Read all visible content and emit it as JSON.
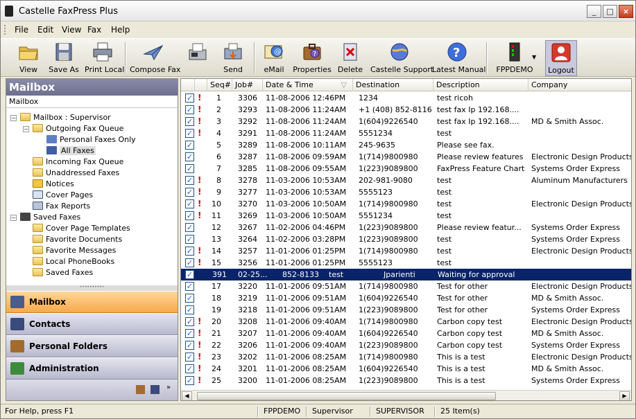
{
  "window": {
    "title": "Castelle FaxPress Plus"
  },
  "menu": [
    "File",
    "Edit",
    "View",
    "Fax",
    "Help"
  ],
  "toolbar": [
    {
      "label": "View",
      "icon": "open-folder-icon"
    },
    {
      "label": "Save As",
      "icon": "floppy-disk-icon"
    },
    {
      "label": "Print Local",
      "icon": "printer-icon"
    },
    {
      "label": "Compose Fax",
      "icon": "paper-plane-icon"
    },
    {
      "label": "",
      "icon": "fax-machine-icon"
    },
    {
      "label": "Send",
      "icon": "send-icon"
    },
    {
      "label": "eMail",
      "icon": "email-icon"
    },
    {
      "label": "Properties",
      "icon": "properties-icon"
    },
    {
      "label": "Delete",
      "icon": "delete-icon"
    },
    {
      "label": "Castelle Support",
      "icon": "support-globe-icon"
    },
    {
      "label": "Latest Manual",
      "icon": "help-icon"
    },
    {
      "label": "FPPDEMO",
      "icon": "server-icon"
    },
    {
      "label": "Logout",
      "icon": "logout-icon"
    }
  ],
  "left": {
    "header": "Mailbox",
    "subheader": "Mailbox",
    "tree": [
      {
        "label": "Mailbox : Supervisor"
      },
      {
        "label": "Outgoing Fax Queue"
      },
      {
        "label": "Personal Faxes Only"
      },
      {
        "label": "All Faxes"
      },
      {
        "label": "Incoming Fax Queue"
      },
      {
        "label": "Unaddressed Faxes"
      },
      {
        "label": "Notices"
      },
      {
        "label": "Cover Pages"
      },
      {
        "label": "Fax Reports"
      },
      {
        "label": "Saved Faxes"
      },
      {
        "label": "Cover Page Templates"
      },
      {
        "label": "Favorite Documents"
      },
      {
        "label": "Favorite Messages"
      },
      {
        "label": "Local PhoneBooks"
      },
      {
        "label": "Saved Faxes"
      }
    ],
    "nav": [
      {
        "label": "Mailbox"
      },
      {
        "label": "Contacts"
      },
      {
        "label": "Personal Folders"
      },
      {
        "label": "Administration"
      }
    ]
  },
  "grid": {
    "columns": [
      "Seq#",
      "Job#",
      "Date & Time",
      "Destination",
      "Description",
      "Company"
    ],
    "rows": [
      {
        "seq": "1",
        "job": "3306",
        "date": "11-08-2006 12:46PM",
        "dest": "1234",
        "desc": "test ricoh",
        "company": "",
        "flag": true
      },
      {
        "seq": "2",
        "job": "3293",
        "date": "11-08-2006 11:24AM",
        "dest": "+1 (408) 852-8116",
        "desc": "test fax Ip 192.168....",
        "company": "",
        "flag": true
      },
      {
        "seq": "3",
        "job": "3292",
        "date": "11-08-2006 11:24AM",
        "dest": "1(604)9226540",
        "desc": "test fax Ip 192.168....",
        "company": "MD & Smith Assoc.",
        "flag": true
      },
      {
        "seq": "4",
        "job": "3291",
        "date": "11-08-2006 11:24AM",
        "dest": "5551234",
        "desc": "test",
        "company": "",
        "flag": true
      },
      {
        "seq": "5",
        "job": "3289",
        "date": "11-08-2006 10:11AM",
        "dest": "245-9635",
        "desc": "Please see fax.",
        "company": "",
        "flag": false
      },
      {
        "seq": "6",
        "job": "3287",
        "date": "11-08-2006 09:59AM",
        "dest": "1(714)9800980",
        "desc": "Please review features",
        "company": "Electronic Design Products",
        "flag": false
      },
      {
        "seq": "7",
        "job": "3285",
        "date": "11-08-2006 09:55AM",
        "dest": "1(223)9089800",
        "desc": "FaxPress Feature Chart",
        "company": "Systems Order Express",
        "flag": false
      },
      {
        "seq": "8",
        "job": "3278",
        "date": "11-03-2006 10:53AM",
        "dest": "202-981-9080",
        "desc": "test",
        "company": "Aluminum Manufacturers",
        "flag": true
      },
      {
        "seq": "9",
        "job": "3277",
        "date": "11-03-2006 10:53AM",
        "dest": "5555123",
        "desc": "test",
        "company": "",
        "flag": true
      },
      {
        "seq": "10",
        "job": "3270",
        "date": "11-03-2006 10:50AM",
        "dest": "1(714)9800980",
        "desc": "test",
        "company": "Electronic Design Products",
        "flag": true
      },
      {
        "seq": "11",
        "job": "3269",
        "date": "11-03-2006 10:50AM",
        "dest": "5551234",
        "desc": "test",
        "company": "",
        "flag": true
      },
      {
        "seq": "12",
        "job": "3267",
        "date": "11-02-2006 04:46PM",
        "dest": "1(223)9089800",
        "desc": "Please review featur...",
        "company": "Systems Order Express",
        "flag": false
      },
      {
        "seq": "13",
        "job": "3264",
        "date": "11-02-2006 03:28PM",
        "dest": "1(223)9089800",
        "desc": "test",
        "company": "Systems Order Express",
        "flag": false
      },
      {
        "seq": "14",
        "job": "3257",
        "date": "11-01-2006 01:25PM",
        "dest": "1(714)9800980",
        "desc": "test",
        "company": "Electronic Design Products",
        "flag": true
      },
      {
        "seq": "15",
        "job": "3256",
        "date": "11-01-2006 01:25PM",
        "dest": "5555123",
        "desc": "test",
        "company": "",
        "flag": true
      },
      {
        "seq": "391",
        "job": "02-25...",
        "date": "852-8133",
        "dest": "test",
        "desc": "Jparienti",
        "company": "Waiting for approval",
        "flag": false,
        "selected": true
      },
      {
        "seq": "17",
        "job": "3220",
        "date": "11-01-2006 09:51AM",
        "dest": "1(714)9800980",
        "desc": "Test for other",
        "company": "Electronic Design Products",
        "flag": false
      },
      {
        "seq": "18",
        "job": "3219",
        "date": "11-01-2006 09:51AM",
        "dest": "1(604)9226540",
        "desc": "Test for other",
        "company": "MD & Smith Assoc.",
        "flag": false
      },
      {
        "seq": "19",
        "job": "3218",
        "date": "11-01-2006 09:51AM",
        "dest": "1(223)9089800",
        "desc": "Test for other",
        "company": "Systems Order Express",
        "flag": false
      },
      {
        "seq": "20",
        "job": "3208",
        "date": "11-01-2006 09:40AM",
        "dest": "1(714)9800980",
        "desc": "Carbon copy test",
        "company": "Electronic Design Products",
        "flag": true
      },
      {
        "seq": "21",
        "job": "3207",
        "date": "11-01-2006 09:40AM",
        "dest": "1(604)9226540",
        "desc": "Carbon copy test",
        "company": "MD & Smith Assoc.",
        "flag": true
      },
      {
        "seq": "22",
        "job": "3206",
        "date": "11-01-2006 09:40AM",
        "dest": "1(223)9089800",
        "desc": "Carbon copy test",
        "company": "Systems Order Express",
        "flag": true
      },
      {
        "seq": "23",
        "job": "3202",
        "date": "11-01-2006 08:25AM",
        "dest": "1(714)9800980",
        "desc": "This is a test",
        "company": "Electronic Design Products",
        "flag": true
      },
      {
        "seq": "24",
        "job": "3201",
        "date": "11-01-2006 08:25AM",
        "dest": "1(604)9226540",
        "desc": "This is a test",
        "company": "MD & Smith Assoc.",
        "flag": true
      },
      {
        "seq": "25",
        "job": "3200",
        "date": "11-01-2006 08:25AM",
        "dest": "1(223)9089800",
        "desc": "This is a test",
        "company": "Systems Order Express",
        "flag": true
      }
    ]
  },
  "status": {
    "help": "For Help, press F1",
    "server": "FPPDEMO",
    "user": "Supervisor",
    "role": "SUPERVISOR",
    "count": "25 Item(s)"
  },
  "colors": {
    "selection": "#0a246a",
    "accent": "#f7a94a",
    "flag": "#e00000",
    "header": "#6d6f90"
  }
}
